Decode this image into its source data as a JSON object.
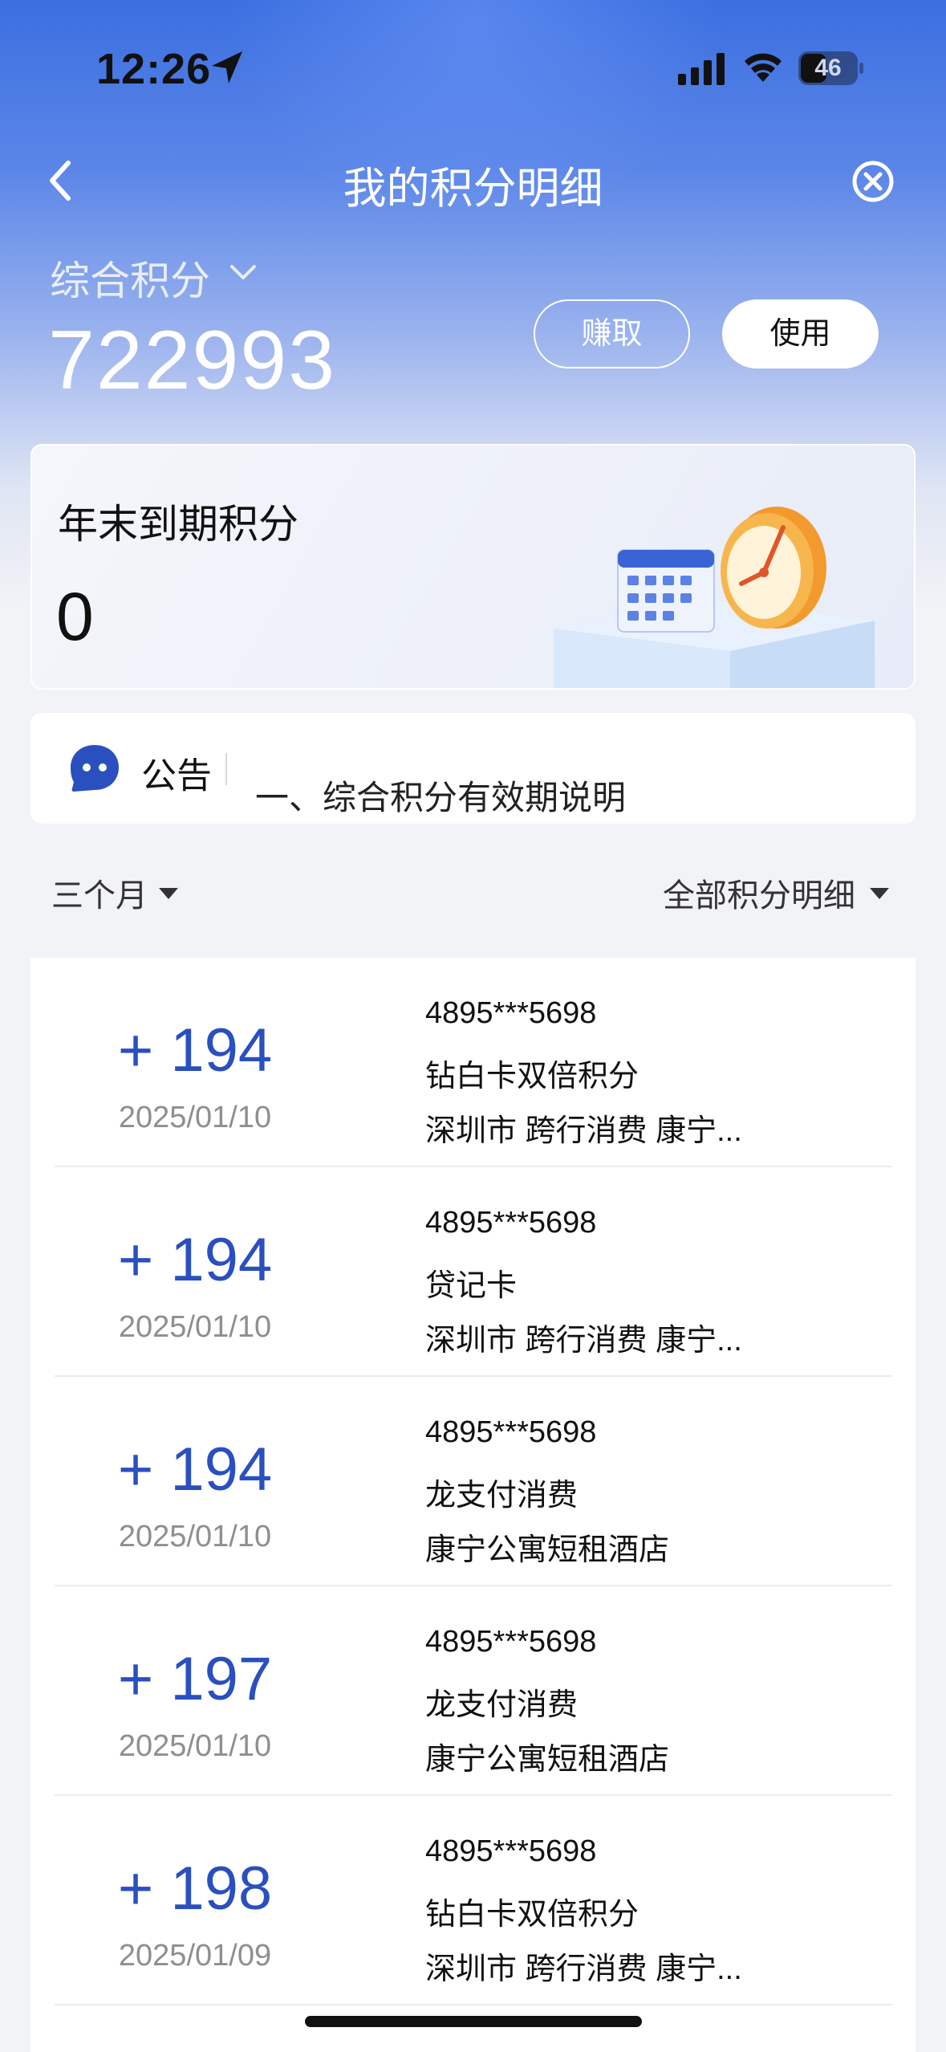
{
  "status_bar": {
    "time": "12:26",
    "battery": "46"
  },
  "nav": {
    "title": "我的积分明细"
  },
  "summary": {
    "label": "综合积分",
    "value": "722993",
    "earn_label": "赚取",
    "use_label": "使用"
  },
  "expiry": {
    "title": "年末到期积分",
    "value": "0"
  },
  "notice": {
    "label": "公告",
    "text": "一、综合积分有效期说明"
  },
  "filters": {
    "period": "三个月",
    "category": "全部积分明细"
  },
  "records": [
    {
      "amount": "+ 194",
      "date": "2025/01/10",
      "card": "4895***5698",
      "type": "钻白卡双倍积分",
      "merchant": "深圳市 跨行消费 康宁..."
    },
    {
      "amount": "+ 194",
      "date": "2025/01/10",
      "card": "4895***5698",
      "type": "贷记卡",
      "merchant": "深圳市 跨行消费 康宁..."
    },
    {
      "amount": "+ 194",
      "date": "2025/01/10",
      "card": "4895***5698",
      "type": "龙支付消费",
      "merchant": "康宁公寓短租酒店"
    },
    {
      "amount": "+ 197",
      "date": "2025/01/10",
      "card": "4895***5698",
      "type": "龙支付消费",
      "merchant": "康宁公寓短租酒店"
    },
    {
      "amount": "+ 198",
      "date": "2025/01/09",
      "card": "4895***5698",
      "type": "钻白卡双倍积分",
      "merchant": "深圳市 跨行消费 康宁..."
    }
  ],
  "colors": {
    "accent": "#2a4fbf",
    "header_top": "#3b6fe0",
    "page_bg": "#f2f3f6"
  }
}
